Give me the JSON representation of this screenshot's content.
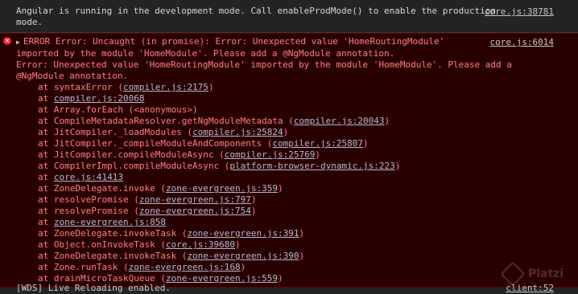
{
  "info_message": {
    "text": "Angular is running in the development mode. Call enableProdMode() to enable the production mode.",
    "source": "core.js:38781"
  },
  "error_message": {
    "icon": "error-icon",
    "toggle": "▶",
    "source": "core.js:6014",
    "header": "ERROR Error: Uncaught (in promise): Error: Unexpected value 'HomeRoutingModule' imported by the module 'HomeModule'. Please add a @NgModule annotation.",
    "detail": "Error: Unexpected value 'HomeRoutingModule' imported by the module 'HomeModule'. Please add a @NgModule annotation.",
    "stack": [
      {
        "prefix": "at syntaxError (",
        "link": "compiler.js:2175",
        "suffix": ")"
      },
      {
        "prefix": "at ",
        "link": "compiler.js:20068",
        "suffix": ""
      },
      {
        "prefix": "at Array.forEach (<anonymous>)",
        "link": "",
        "suffix": ""
      },
      {
        "prefix": "at CompileMetadataResolver.getNgModuleMetadata (",
        "link": "compiler.js:20043",
        "suffix": ")"
      },
      {
        "prefix": "at JitCompiler._loadModules (",
        "link": "compiler.js:25824",
        "suffix": ")"
      },
      {
        "prefix": "at JitCompiler._compileModuleAndComponents (",
        "link": "compiler.js:25807",
        "suffix": ")"
      },
      {
        "prefix": "at JitCompiler.compileModuleAsync (",
        "link": "compiler.js:25769",
        "suffix": ")"
      },
      {
        "prefix": "at CompilerImpl.compileModuleAsync (",
        "link": "platform-browser-dynamic.js:223",
        "suffix": ")"
      },
      {
        "prefix": "at ",
        "link": "core.js:41413",
        "suffix": ""
      },
      {
        "prefix": "at ZoneDelegate.invoke (",
        "link": "zone-evergreen.js:359",
        "suffix": ")"
      },
      {
        "prefix": "at resolvePromise (",
        "link": "zone-evergreen.js:797",
        "suffix": ")"
      },
      {
        "prefix": "at resolvePromise (",
        "link": "zone-evergreen.js:754",
        "suffix": ")"
      },
      {
        "prefix": "at ",
        "link": "zone-evergreen.js:858",
        "suffix": ""
      },
      {
        "prefix": "at ZoneDelegate.invokeTask (",
        "link": "zone-evergreen.js:391",
        "suffix": ")"
      },
      {
        "prefix": "at Object.onInvokeTask (",
        "link": "core.js:39680",
        "suffix": ")"
      },
      {
        "prefix": "at ZoneDelegate.invokeTask (",
        "link": "zone-evergreen.js:390",
        "suffix": ")"
      },
      {
        "prefix": "at Zone.runTask (",
        "link": "zone-evergreen.js:168",
        "suffix": ")"
      },
      {
        "prefix": "at drainMicroTaskQueue (",
        "link": "zone-evergreen.js:559",
        "suffix": ")"
      }
    ]
  },
  "live_message": {
    "text": "[WDS] Live Reloading enabled.",
    "source": "client:52"
  },
  "watermark": {
    "text": "Platzi",
    "icon": "platzi-logo"
  },
  "colors": {
    "background": "#242424",
    "error_background": "#290000",
    "error_text": "#ff8080",
    "info_text": "#d6d6d6"
  }
}
